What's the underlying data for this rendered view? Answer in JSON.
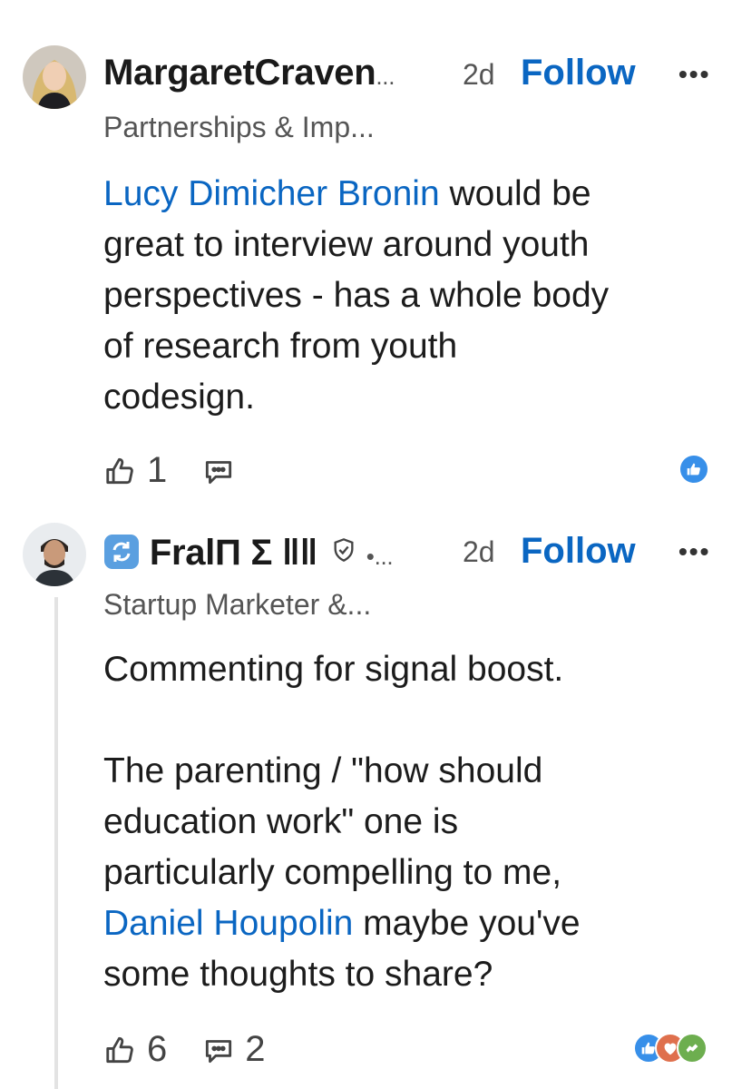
{
  "comments": [
    {
      "author": "Margaret",
      "author_obscured": "Craven",
      "author_ellipsis": "...",
      "time": "2d",
      "follow_label": "Follow",
      "more_label": "•••",
      "headline": "Partnerships & Imp...",
      "mention": "Lucy Dimicher Bronin",
      "body_lines": [
        " would be",
        "great to interview around youth",
        "perspectives - has a whole body",
        "of research from youth",
        "codesign."
      ],
      "like_count": "1",
      "comment_count": ""
    },
    {
      "author": "Fral",
      "author_obscured": "Π Σ ǁǁ",
      "author_ellipsis": "•...",
      "time": "2d",
      "follow_label": "Follow",
      "more_label": "•••",
      "headline": "Startup Marketer &...",
      "para1": "Commenting for signal boost.",
      "para2_lines": [
        "The parenting / \"how should",
        "education work\" one is",
        "particularly compelling to me,"
      ],
      "mention": "Daniel Houpolin",
      "after_mention": " maybe you've",
      "last_line": "some thoughts to share?",
      "like_count": "6",
      "comment_count": "2"
    }
  ],
  "colors": {
    "accent": "#0a66c2",
    "text": "#1c1c1c",
    "muted": "#555555",
    "like_reaction": "#378fe9",
    "love_reaction": "#df704d",
    "support_reaction": "#6dae4f"
  },
  "icons": [
    "thumbs-up-icon",
    "comment-icon",
    "more-icon",
    "refresh-badge-icon",
    "verified-shield-icon",
    "like-reaction-icon",
    "love-reaction-icon",
    "support-reaction-icon"
  ]
}
